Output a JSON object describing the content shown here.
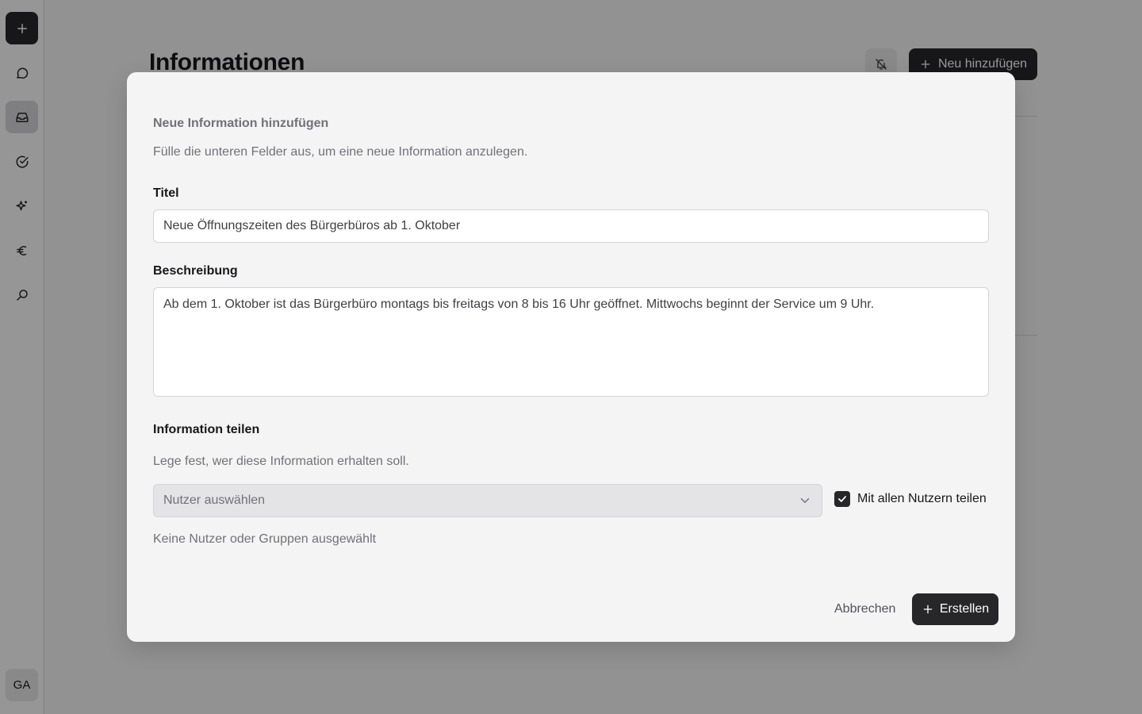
{
  "sidebar": {
    "items": [
      {
        "name": "plus-icon",
        "active": false
      },
      {
        "name": "chat-icon",
        "active": false
      },
      {
        "name": "inbox-icon",
        "active": true
      },
      {
        "name": "check-circle-icon",
        "active": false
      },
      {
        "name": "sparkle-icon",
        "active": false
      },
      {
        "name": "euro-icon",
        "active": false
      },
      {
        "name": "search-icon",
        "active": false
      }
    ],
    "avatar_initials": "GA"
  },
  "page": {
    "title": "Informationen",
    "add_button_label": "Neu hinzufügen",
    "bell_icon": "bell-off-icon"
  },
  "modal": {
    "title": "Neue Information hinzufügen",
    "description": "Fülle die unteren Felder aus, um eine neue Information anzulegen.",
    "title_label": "Titel",
    "title_value": "Neue Öffnungszeiten des Bürgerbüros ab 1. Oktober",
    "description_label": "Beschreibung",
    "description_value": "Ab dem 1. Oktober ist das Bürgerbüro montags bis freitags von 8 bis 16 Uhr geöffnet. Mittwochs beginnt der Service um 9 Uhr.",
    "share_label": "Information teilen",
    "share_description": "Lege fest, wer diese Information erhalten soll.",
    "user_select_placeholder": "Nutzer auswählen",
    "share_all_label": "Mit allen Nutzern teilen",
    "share_all_checked": true,
    "no_selection_text": "Keine Nutzer oder Gruppen ausgewählt",
    "cancel_label": "Abbrechen",
    "create_label": "Erstellen"
  },
  "colors": {
    "primary": "#27272a",
    "background": "#f4f4f5",
    "muted_text": "#71717a"
  }
}
